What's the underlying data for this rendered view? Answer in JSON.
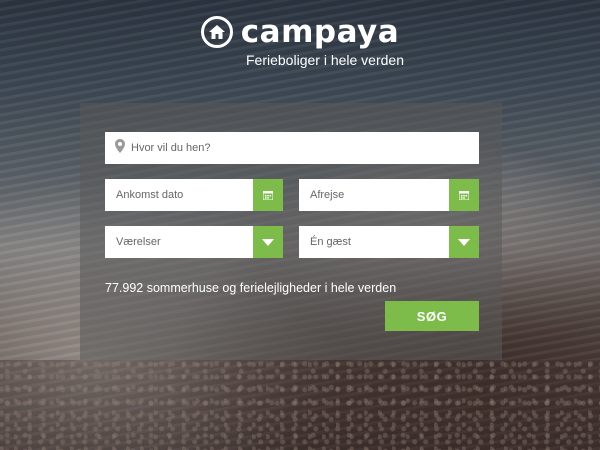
{
  "brand": {
    "name": "campaya",
    "tagline": "Ferieboliger i hele verden"
  },
  "search": {
    "destination_placeholder": "Hvor vil du hen?",
    "arrival_placeholder": "Ankomst dato",
    "departure_placeholder": "Afrejse",
    "rooms_selected": "Værelser",
    "guests_selected": "Én gæst",
    "listing_count_text": "77.992 sommerhuse og ferielejligheder i hele verden",
    "submit_label": "SØG"
  },
  "icons": {
    "logo": "house-icon",
    "destination": "location-pin-icon",
    "calendar": "calendar-icon",
    "dropdown": "chevron-down-icon"
  },
  "colors": {
    "accent": "#7dbb4a",
    "panel_overlay": "#5a5a5a"
  }
}
